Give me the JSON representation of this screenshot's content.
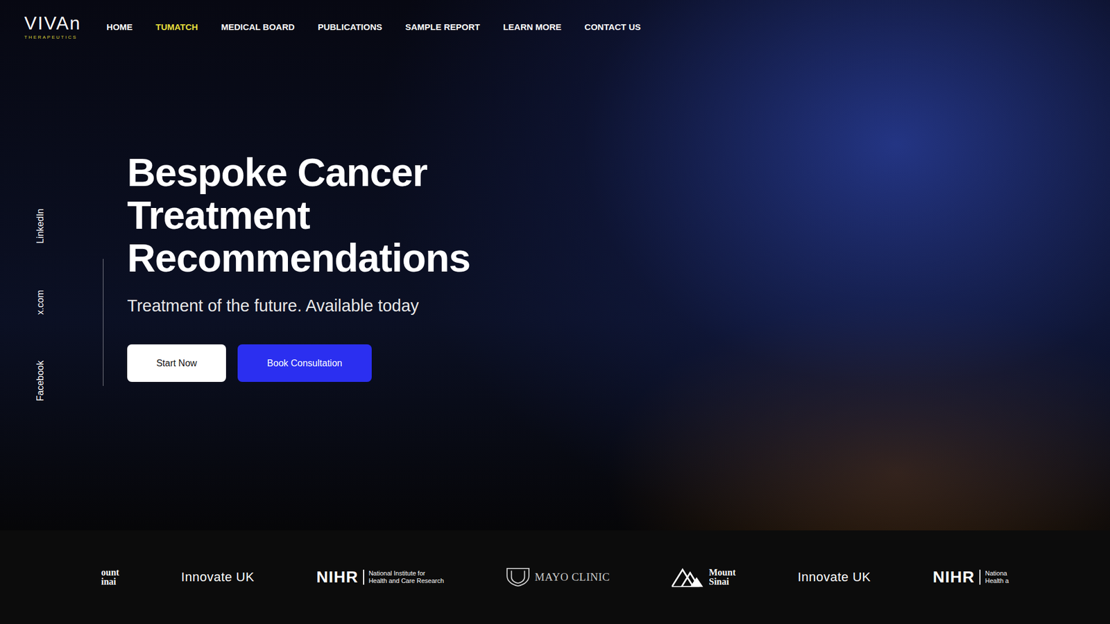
{
  "logo": {
    "name": "VIVAn",
    "tagline": "THERAPEUTICS"
  },
  "nav": [
    {
      "label": "HOME",
      "selected": false
    },
    {
      "label": "TUMATCH",
      "selected": true
    },
    {
      "label": "MEDICAL BOARD",
      "selected": false
    },
    {
      "label": "PUBLICATIONS",
      "selected": false
    },
    {
      "label": "SAMPLE REPORT",
      "selected": false
    },
    {
      "label": "LEARN MORE",
      "selected": false
    },
    {
      "label": "CONTACT US",
      "selected": false
    }
  ],
  "social": [
    "LinkedIn",
    "x.com",
    "Facebook"
  ],
  "hero": {
    "title": [
      "Bespoke Cancer",
      "Treatment",
      "Recommendations"
    ],
    "subtitle": "Treatment of the future. Available today",
    "buttons": [
      {
        "label": "Start Now",
        "kind": "secondary"
      },
      {
        "label": "Book Consultation",
        "kind": "primary"
      }
    ]
  },
  "partners": [
    {
      "kind": "sinai",
      "icon": false,
      "name": "ount",
      "sub": "inai"
    },
    {
      "kind": "word",
      "name": "Innovate UK"
    },
    {
      "kind": "nihr",
      "name": "NIHR",
      "sub": "National Institute for",
      "sub2": "Health and Care Research"
    },
    {
      "kind": "mayo",
      "name": "MAYO CLINIC"
    },
    {
      "kind": "sinai",
      "icon": true,
      "name": "Mount",
      "sub": "Sinai"
    },
    {
      "kind": "word",
      "name": "Innovate UK"
    },
    {
      "kind": "nihr",
      "name": "NIHR",
      "sub": "Nationa",
      "sub2": "Health a"
    }
  ]
}
